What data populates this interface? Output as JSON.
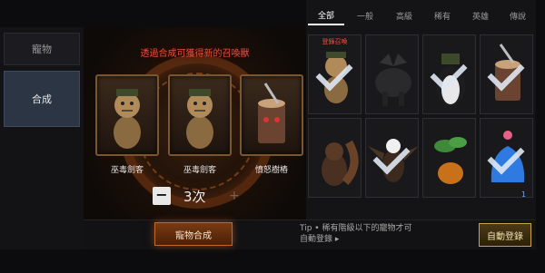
{
  "sidebar": {
    "items": [
      {
        "label": "寵物",
        "active": false
      },
      {
        "label": "合成",
        "active": true
      }
    ]
  },
  "fusion": {
    "hint": "透過合成可獲得新的召喚獸",
    "slots": [
      {
        "name": "巫毒劍客",
        "icon": "voodoo-doll"
      },
      {
        "name": "巫毒劍客",
        "icon": "voodoo-doll"
      },
      {
        "name": "憤怒樹樁",
        "icon": "angry-stump"
      }
    ],
    "count": "3次",
    "minus_label": "−",
    "plus_label": "+"
  },
  "tabs": [
    {
      "label": "全部",
      "active": true
    },
    {
      "label": "一般"
    },
    {
      "label": "高級"
    },
    {
      "label": "稀有"
    },
    {
      "label": "英雄"
    },
    {
      "label": "傳說"
    }
  ],
  "grid": {
    "registered_label": "登錄召喚",
    "cards": [
      {
        "icon": "voodoo-doll",
        "checked": true,
        "registered": true
      },
      {
        "icon": "black-wolf",
        "checked": false
      },
      {
        "icon": "penguin-soldier",
        "checked": true
      },
      {
        "icon": "angry-stump",
        "checked": true
      },
      {
        "icon": "squirrel",
        "checked": false
      },
      {
        "icon": "eagle",
        "checked": true
      },
      {
        "icon": "leaf-sprout",
        "checked": false
      },
      {
        "icon": "blue-slime",
        "checked": true
      }
    ]
  },
  "bottom": {
    "fuse_label": "寵物合成",
    "tip_line1": "Tip • 稀有階級以下的寵物才可",
    "tip_line2": "自動登錄 ▸",
    "auto_label": "自動登錄"
  },
  "colors": {
    "accent_orange": "#c0682a",
    "hint_red": "#e0503a",
    "gold": "#c9a24a"
  }
}
